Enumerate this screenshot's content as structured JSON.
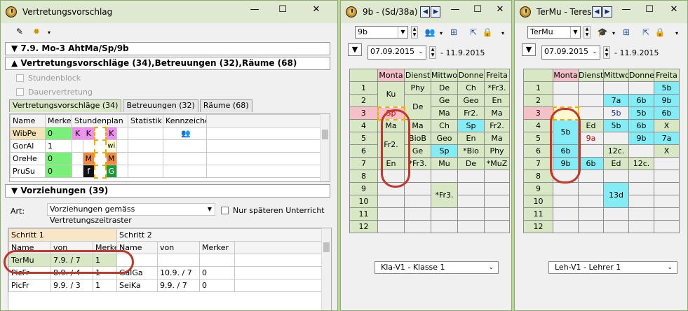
{
  "win1": {
    "title": "Vertretungsvorschlag",
    "header_line": "7.9. Mo-3 AhtMa/Sp/9b",
    "section_vorschlaege": "Vertretungsvorschläge (34),Betreuungen (32),Räume (68)",
    "chk_stundenblock": "Stundenblock",
    "chk_dauervertretung": "Dauervertretung",
    "tabs": [
      "Vertretungsvorschläge (34)",
      "Betreuungen (32)",
      "Räume (68)"
    ],
    "grid_headers": [
      "Name",
      "Merker",
      "Stundenplan",
      "Statistik",
      "Kennzeichen"
    ],
    "grid_rows": [
      {
        "name": "WibPe",
        "merker": "0",
        "cells": [
          "K",
          "K",
          "",
          "K"
        ]
      },
      {
        "name": "GorAl",
        "merker": "1",
        "cells": [
          "",
          "",
          "",
          "wi"
        ]
      },
      {
        "name": "OreHe",
        "merker": "0",
        "cells": [
          "",
          "M",
          "",
          "M"
        ]
      },
      {
        "name": "PruSu",
        "merker": "0",
        "cells": [
          "",
          "f",
          "",
          "G"
        ]
      }
    ],
    "section_vorziehungen": "Vorziehungen (39)",
    "art_label": "Art:",
    "art_value": "Vorziehungen gemäss Vertretungszeitraster",
    "chk_nur_spaeter": "Nur späteren Unterricht",
    "schritt1": "Schritt 1",
    "schritt2": "Schritt 2",
    "v_headers": [
      "Name",
      "von",
      "Merke",
      "Name",
      "von",
      "Merker"
    ],
    "v_rows": [
      [
        "TerMu",
        "7.9. / 7",
        "1",
        "",
        "",
        ""
      ],
      [
        "PicFr",
        "8.9. / 4",
        "1",
        "GalGa",
        "10.9. / 7",
        "0"
      ],
      [
        "PicFr",
        "9.9. / 3",
        "1",
        "SeiKa",
        "9.9. / 7",
        "0"
      ]
    ]
  },
  "win2": {
    "title": "9b - (Sd/38a)",
    "combo_value": "9b",
    "date_from": "07.09.2015",
    "date_to": "- 11.9.2015",
    "days": [
      "Monta",
      "Dienst",
      "Mittwo",
      "Donne",
      "Freita"
    ],
    "hours": [
      "1",
      "2",
      "3",
      "4",
      "5",
      "6",
      "7",
      "8",
      "9",
      "10",
      "11",
      "12"
    ],
    "footer": "Kla-V1 - Klasse 1",
    "lessons": {
      "mon": [
        "Ku",
        "Sp",
        "Ma",
        "Fr2.",
        "En"
      ],
      "tue": [
        "Phy",
        "De",
        "Ma",
        "BioB",
        "Ge",
        "*Fr3."
      ],
      "wed": [
        "De",
        "Ge",
        "Ma",
        "Ch",
        "Geo",
        "Sp",
        "Mu",
        "*Fr3."
      ],
      "thu": [
        "Ch",
        "Geo",
        "Fr2.",
        "Sp",
        "En",
        "*Bio",
        "De"
      ],
      "fri": [
        "*Fr3.",
        "En",
        "Ma",
        "Fr2.",
        "Ma",
        "Phy",
        "*MuZ"
      ]
    }
  },
  "win3": {
    "title": "TerMu - Teresa",
    "combo_value": "TerMu",
    "date_from": "07.09.2015",
    "date_to": "- 11.9.2015",
    "days": [
      "Monta",
      "Dienst",
      "Mittwo",
      "Donne",
      "Freita"
    ],
    "hours": [
      "1",
      "2",
      "3",
      "4",
      "5",
      "6",
      "7",
      "8",
      "9",
      "10",
      "11",
      "12"
    ],
    "footer": "Leh-V1 - Lehrer 1",
    "lessons": {
      "mon": [
        "5b",
        "6b",
        "9b"
      ],
      "tue": [
        "Ed",
        "9a",
        "6b"
      ],
      "wed": [
        "7a",
        "5b",
        "5b",
        "12c.",
        "Ed",
        "13d"
      ],
      "thu": [
        "6b",
        "5b",
        "6b",
        "9b",
        "12c."
      ],
      "fri": [
        "5b",
        "9b",
        "6b",
        "X",
        "7a",
        "X"
      ]
    }
  },
  "colors": {
    "frame": "#8ab06c",
    "header_green": "#d8e7c4",
    "pink": "#f5c0c8",
    "cyan": "#84ecf4",
    "magenta": "#f08ef0",
    "orange": "#f08a3c",
    "circle": "#c0392b"
  }
}
